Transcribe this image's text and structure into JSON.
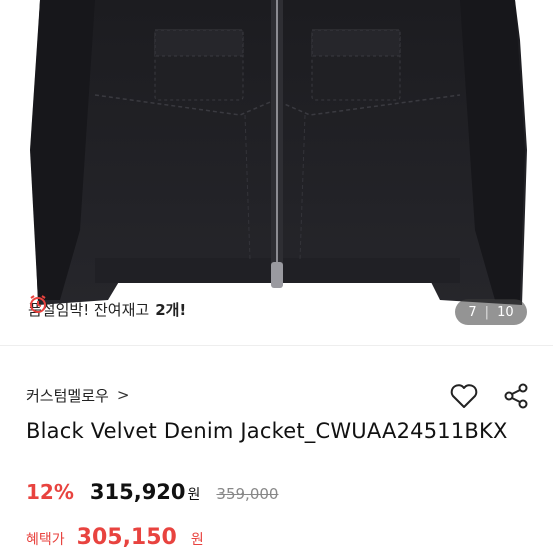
{
  "product_image": {
    "description_icon": "jacket-photo"
  },
  "stock_notice": {
    "icon": "alarm-clock-icon",
    "text": "품절임박! 잔여재고",
    "count": "2개!"
  },
  "pager": {
    "current": "7",
    "separator": "|",
    "total": "10"
  },
  "brand": {
    "name": "커스텀멜로우",
    "chevron": ">"
  },
  "actions": {
    "like_icon": "heart-icon",
    "share_icon": "share-icon"
  },
  "product": {
    "title": "Black Velvet Denim Jacket_CWUAA24511BKX"
  },
  "pricing": {
    "discount": "12%",
    "price": "315,920",
    "currency": "원",
    "original": "359,000",
    "benefit_label": "혜택가",
    "benefit_price": "305,150",
    "benefit_currency": "원"
  },
  "colors": {
    "accent": "#e8433f"
  }
}
